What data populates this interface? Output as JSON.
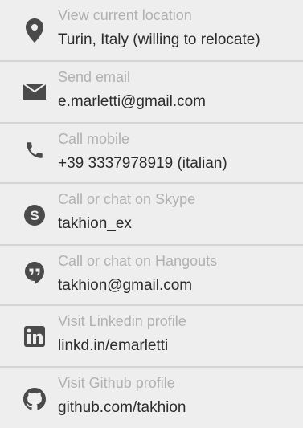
{
  "contacts": [
    {
      "label": "View current location",
      "value": "Turin, Italy (willing to relocate)",
      "icon": "location-pin-icon"
    },
    {
      "label": "Send email",
      "value": "e.marletti@gmail.com",
      "icon": "email-icon"
    },
    {
      "label": "Call mobile",
      "value": "+39 3337978919 (italian)",
      "icon": "phone-icon"
    },
    {
      "label": "Call or chat on Skype",
      "value": "takhion_ex",
      "icon": "skype-icon"
    },
    {
      "label": "Call or chat on Hangouts",
      "value": "takhion@gmail.com",
      "icon": "hangouts-icon"
    },
    {
      "label": "Visit Linkedin profile",
      "value": "linkd.in/emarletti",
      "icon": "linkedin-icon"
    },
    {
      "label": "Visit Github profile",
      "value": "github.com/takhion",
      "icon": "github-icon"
    }
  ],
  "colors": {
    "background": "#eeeeee",
    "label": "#b1b1b1",
    "value": "#2c2c2c",
    "icon": "#4a4a4a",
    "divider": "#d4d4d4"
  }
}
